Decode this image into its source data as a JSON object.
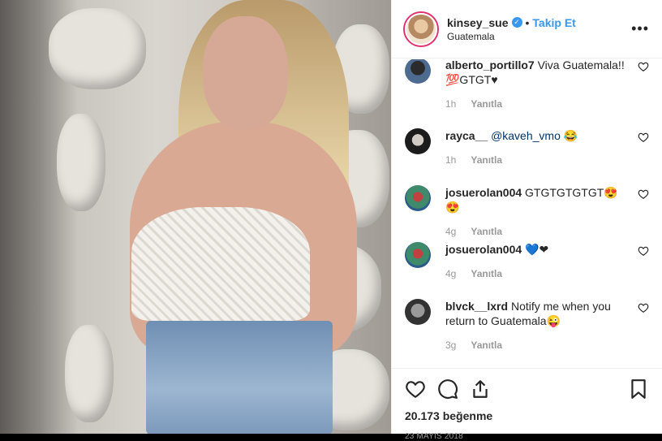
{
  "post": {
    "username": "kinsey_sue",
    "verified": true,
    "follow_label": "Takip Et",
    "separator": "•",
    "location": "Guatemala",
    "more_label": "•••"
  },
  "comments": [
    {
      "user": "alberto_portillo7",
      "text": "Viva Guatemala!! 💯GTGT♥",
      "time": "1h",
      "reply": "Yanıtla"
    },
    {
      "user": "rayca__",
      "mention": "@kaveh_vmo",
      "text": " 😂",
      "time": "1h",
      "reply": "Yanıtla"
    },
    {
      "user": "josuerolan004",
      "text": "GTGTGTGTGT😍😍",
      "time": "4g",
      "reply": "Yanıtla"
    },
    {
      "user": "josuerolan004",
      "text": "💙❤",
      "time": "4g",
      "reply": "Yanıtla"
    },
    {
      "user": "blvck__lxrd",
      "text": "Notify me when you return to Guatemala😜",
      "time": "3g",
      "reply": "Yanıtla"
    }
  ],
  "actions": {
    "likes_count": "20.173",
    "likes_label": "beğenme",
    "date": "23 MAYIS 2018"
  },
  "icons": [
    "heart-icon",
    "comment-icon",
    "share-icon",
    "bookmark-icon",
    "verified-icon",
    "more-icon"
  ],
  "colors": {
    "accent": "#3897f0",
    "text": "#262626",
    "muted": "#999999"
  }
}
